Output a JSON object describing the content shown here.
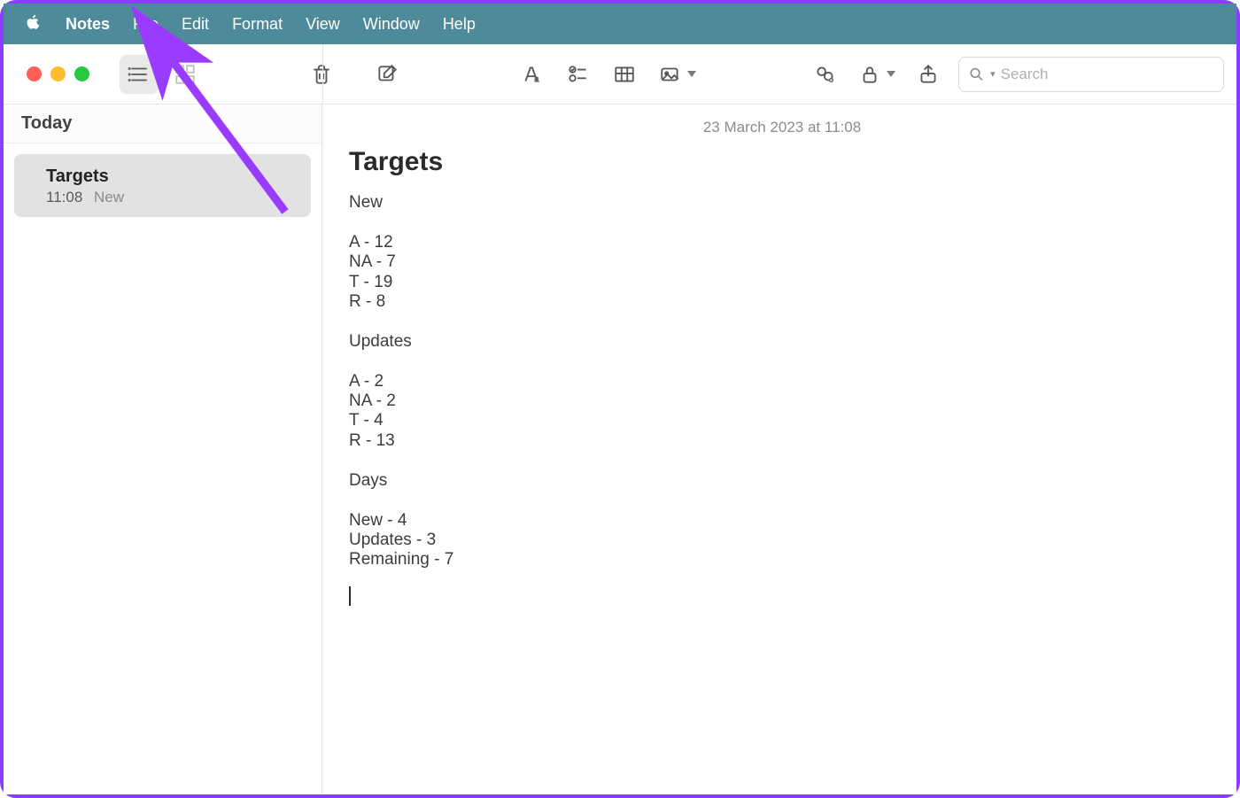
{
  "menubar": {
    "app": "Notes",
    "items": [
      "File",
      "Edit",
      "Format",
      "View",
      "Window",
      "Help"
    ]
  },
  "search": {
    "placeholder": "Search"
  },
  "sidebar": {
    "section": "Today",
    "notes": [
      {
        "title": "Targets",
        "time": "11:08",
        "preview": "New"
      }
    ]
  },
  "editor": {
    "timestamp": "23 March 2023 at 11:08",
    "title": "Targets",
    "body": "New\n\nA - 12\nNA - 7\nT - 19\nR - 8\n\nUpdates\n\nA - 2\nNA - 2\nT - 4\nR - 13\n\nDays\n\nNew - 4\nUpdates - 3\nRemaining - 7"
  },
  "annotation": {
    "color": "#9a3cff"
  }
}
